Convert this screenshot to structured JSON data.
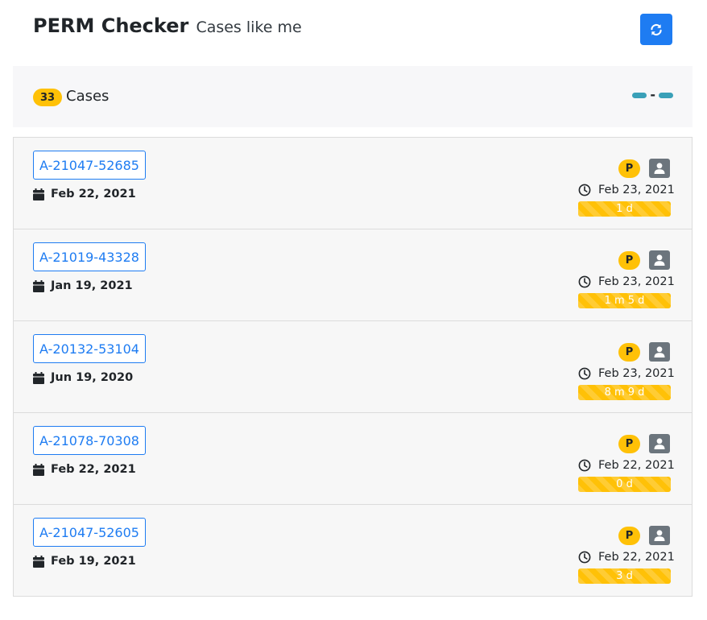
{
  "header": {
    "title": "PERM Checker",
    "subtitle": "Cases like me",
    "refresh_icon": "refresh-icon"
  },
  "summary": {
    "count": "33",
    "label": "Cases",
    "range_separator": "-"
  },
  "colors": {
    "primary": "#1e7cf2",
    "warning": "#ffc107",
    "info": "#3aa0b8",
    "secondary": "#6c757d"
  },
  "cases": [
    {
      "id": "A-21047-52685",
      "filed": "Feb 22, 2021",
      "status": "P",
      "updated": "Feb 23, 2021",
      "duration": "1 d"
    },
    {
      "id": "A-21019-43328",
      "filed": "Jan 19, 2021",
      "status": "P",
      "updated": "Feb 23, 2021",
      "duration": "1 m 5 d"
    },
    {
      "id": "A-20132-53104",
      "filed": "Jun 19, 2020",
      "status": "P",
      "updated": "Feb 23, 2021",
      "duration": "8 m 9 d"
    },
    {
      "id": "A-21078-70308",
      "filed": "Feb 22, 2021",
      "status": "P",
      "updated": "Feb 22, 2021",
      "duration": "0 d"
    },
    {
      "id": "A-21047-52605",
      "filed": "Feb 19, 2021",
      "status": "P",
      "updated": "Feb 22, 2021",
      "duration": "3 d"
    }
  ]
}
